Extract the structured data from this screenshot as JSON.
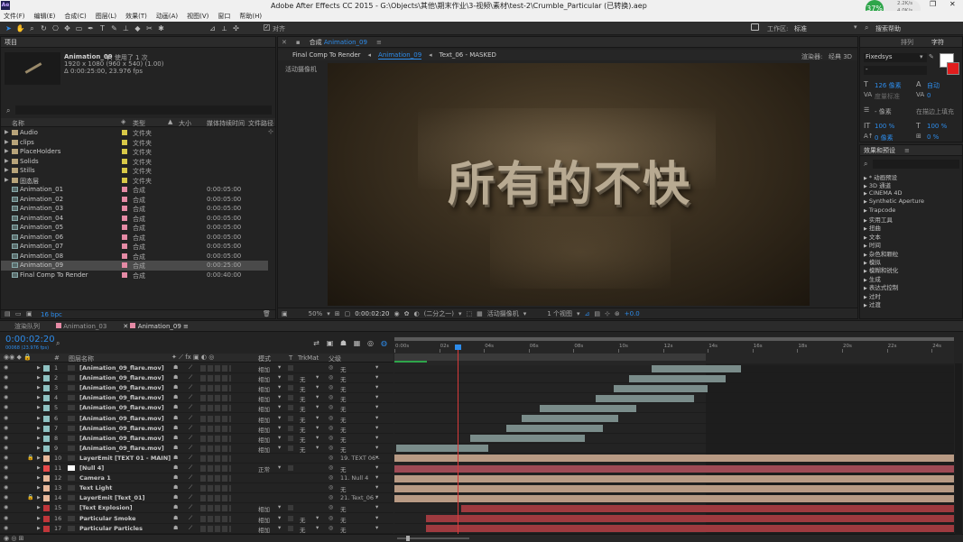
{
  "window": {
    "title": "Adobe After Effects CC 2015 - G:\\Objects\\其他\\期末作业\\3-视频\\素材\\test-2\\Crumble_Particular (已转换).aep",
    "app_icon": "Ae",
    "percent": "37%",
    "net_up": "2.2K/s",
    "net_down": "4.0K/s"
  },
  "menu": [
    "文件(F)",
    "编辑(E)",
    "合成(C)",
    "图层(L)",
    "效果(T)",
    "动画(A)",
    "视图(V)",
    "窗口",
    "帮助(H)"
  ],
  "toolbar": {
    "align": "对齐",
    "workspace_label": "工作区:",
    "workspace_value": "标准",
    "search": "搜索帮助"
  },
  "project": {
    "tab": "项目",
    "thumb_name": "Animation_09",
    "used": "▼, 使用了 1 次",
    "resolution": "1920 x 1080 (960 x 540) (1.00)",
    "duration": "Δ 0:00:25:00, 23.976 fps",
    "search_placeholder": "",
    "cols": {
      "name": "名称",
      "type": "类型",
      "size": "大小",
      "duration": "媒体持续时间",
      "path": "文件路径"
    },
    "items": [
      {
        "name": "Audio",
        "type": "文件夹",
        "dur": "",
        "color": "#d8c847",
        "kind": "folder"
      },
      {
        "name": "clips",
        "type": "文件夹",
        "dur": "",
        "color": "#d8c847",
        "kind": "folder"
      },
      {
        "name": "PlaceHolders",
        "type": "文件夹",
        "dur": "",
        "color": "#d8c847",
        "kind": "folder"
      },
      {
        "name": "Solids",
        "type": "文件夹",
        "dur": "",
        "color": "#d8c847",
        "kind": "folder"
      },
      {
        "name": "Stills",
        "type": "文件夹",
        "dur": "",
        "color": "#d8c847",
        "kind": "folder"
      },
      {
        "name": "固态层",
        "type": "文件夹",
        "dur": "",
        "color": "#d8c847",
        "kind": "folder"
      },
      {
        "name": "Animation_01",
        "type": "合成",
        "dur": "0:00:05:00",
        "color": "#e58aa5",
        "kind": "comp"
      },
      {
        "name": "Animation_02",
        "type": "合成",
        "dur": "0:00:05:00",
        "color": "#e58aa5",
        "kind": "comp"
      },
      {
        "name": "Animation_03",
        "type": "合成",
        "dur": "0:00:05:00",
        "color": "#e58aa5",
        "kind": "comp"
      },
      {
        "name": "Animation_04",
        "type": "合成",
        "dur": "0:00:05:00",
        "color": "#e58aa5",
        "kind": "comp"
      },
      {
        "name": "Animation_05",
        "type": "合成",
        "dur": "0:00:05:00",
        "color": "#e58aa5",
        "kind": "comp"
      },
      {
        "name": "Animation_06",
        "type": "合成",
        "dur": "0:00:05:00",
        "color": "#e58aa5",
        "kind": "comp"
      },
      {
        "name": "Animation_07",
        "type": "合成",
        "dur": "0:00:05:00",
        "color": "#e58aa5",
        "kind": "comp"
      },
      {
        "name": "Animation_08",
        "type": "合成",
        "dur": "0:00:05:00",
        "color": "#e58aa5",
        "kind": "comp"
      },
      {
        "name": "Animation_09",
        "type": "合成",
        "dur": "0:00:25:00",
        "color": "#e58aa5",
        "kind": "comp"
      },
      {
        "name": "Final Comp To Render",
        "type": "合成",
        "dur": "0:00:40:00",
        "color": "#e58aa5",
        "kind": "comp"
      }
    ],
    "bpc": "16 bpc"
  },
  "comp": {
    "tab": "合成",
    "tab_name": "Animation_09",
    "crumbs": [
      "Final Comp To Render",
      "Animation_09",
      "Text_06 - MASKED"
    ],
    "renderer_label": "渲染器:",
    "renderer_value": "经典 3D",
    "camera_label": "活动摄像机",
    "viewer_text": "所有的不快",
    "zoom": "50%",
    "time": "0:00:02:20",
    "resolution": "(二分之一)",
    "camera": "活动摄像机",
    "views": "1 个视图",
    "exposure": "+0.0"
  },
  "right": {
    "tabs": [
      "排列",
      "字符"
    ],
    "font": "Fixedsys",
    "style": "-",
    "size": "126 像素",
    "leading": "自动",
    "tracking_label": "度量标准",
    "kern": "0",
    "stroke": "- 像素",
    "stroke_mode": "在描边上填充",
    "vscale": "100 %",
    "hscale": "100 %",
    "baseline": "0 像素",
    "tsume": "0 %",
    "effects_tab": "效果和预设",
    "effects": [
      "* 动画预设",
      "3D 通道",
      "CINEMA 4D",
      "Synthetic Aperture",
      "Trapcode",
      "实用工具",
      "扭曲",
      "文本",
      "时间",
      "杂色和颗粒",
      "模拟",
      "模糊和锐化",
      "生成",
      "表达式控制",
      "过时",
      "过渡"
    ]
  },
  "timeline": {
    "tabs": [
      "渲染队列",
      "Animation_03",
      "Animation_09"
    ],
    "time": "0:00:02:20",
    "fps": "00068 (23.976 fps)",
    "cols": {
      "num": "#",
      "name": "图层名称",
      "mode": "模式",
      "t": "T",
      "trkmat": "TrkMat",
      "parent": "父级"
    },
    "ruler": [
      "0:00s",
      "02s",
      "04s",
      "06s",
      "08s",
      "10s",
      "12s",
      "14s",
      "16s",
      "18s",
      "20s",
      "22s",
      "24s"
    ],
    "playhead": 2.83,
    "layers": [
      {
        "n": "1",
        "name": "[Animation_09_flare.mov]",
        "mode": "相加",
        "trk": "",
        "parent": "无",
        "color": "#8fc2c2",
        "start": 11.5,
        "end": 15.5,
        "bar": "#7a8c8a"
      },
      {
        "n": "2",
        "name": "[Animation_09_flare.mov]",
        "mode": "相加",
        "trk": "无",
        "parent": "无",
        "color": "#8fc2c2",
        "start": 10.5,
        "end": 14.8,
        "bar": "#7a8c8a"
      },
      {
        "n": "3",
        "name": "[Animation_09_flare.mov]",
        "mode": "相加",
        "trk": "无",
        "parent": "无",
        "color": "#8fc2c2",
        "start": 9.8,
        "end": 14.0,
        "bar": "#7a8c8a"
      },
      {
        "n": "4",
        "name": "[Animation_09_flare.mov]",
        "mode": "相加",
        "trk": "无",
        "parent": "无",
        "color": "#8fc2c2",
        "start": 9.0,
        "end": 13.4,
        "bar": "#7a8c8a"
      },
      {
        "n": "5",
        "name": "[Animation_09_flare.mov]",
        "mode": "相加",
        "trk": "无",
        "parent": "无",
        "color": "#8fc2c2",
        "start": 6.5,
        "end": 10.8,
        "bar": "#7a8c8a"
      },
      {
        "n": "6",
        "name": "[Animation_09_flare.mov]",
        "mode": "相加",
        "trk": "无",
        "parent": "无",
        "color": "#8fc2c2",
        "start": 5.7,
        "end": 10.0,
        "bar": "#7a8c8a"
      },
      {
        "n": "7",
        "name": "[Animation_09_flare.mov]",
        "mode": "相加",
        "trk": "无",
        "parent": "无",
        "color": "#8fc2c2",
        "start": 5.0,
        "end": 9.3,
        "bar": "#7a8c8a"
      },
      {
        "n": "8",
        "name": "[Animation_09_flare.mov]",
        "mode": "相加",
        "trk": "无",
        "parent": "无",
        "color": "#8fc2c2",
        "start": 3.4,
        "end": 8.5,
        "bar": "#7a8c8a"
      },
      {
        "n": "9",
        "name": "[Animation_09_flare.mov]",
        "mode": "相加",
        "trk": "无",
        "parent": "无",
        "color": "#8fc2c2",
        "start": 0.1,
        "end": 4.2,
        "bar": "#7a8c8a"
      },
      {
        "n": "10",
        "name": "LayerEmit [TEXT 01 - MAIN]",
        "mode": "",
        "trk": "",
        "parent": "19. TEXT 06 -",
        "color": "#e8b89a",
        "start": 0,
        "end": 25,
        "bar": "#b89a84"
      },
      {
        "n": "11",
        "name": "[Null 4]",
        "mode": "正常",
        "trk": "",
        "parent": "无",
        "color": "#e84a4a",
        "start": 0,
        "end": 25,
        "bar": "#9e4a55"
      },
      {
        "n": "12",
        "name": "Camera 1",
        "mode": "",
        "trk": "",
        "parent": "11. Null 4",
        "color": "#e8b89a",
        "start": 0,
        "end": 25,
        "bar": "#b89a84"
      },
      {
        "n": "13",
        "name": "Text Light",
        "mode": "",
        "trk": "",
        "parent": "无",
        "color": "#e8b89a",
        "start": 0,
        "end": 25,
        "bar": "#b89a84"
      },
      {
        "n": "14",
        "name": "LayerEmit [Text_01]",
        "mode": "",
        "trk": "",
        "parent": "21. Text_06 -",
        "color": "#e8b89a",
        "start": 0,
        "end": 25,
        "bar": "#b89a84"
      },
      {
        "n": "15",
        "name": "[Text Explosion]",
        "mode": "相加",
        "trk": "",
        "parent": "无",
        "color": "#c0363a",
        "start": 3.0,
        "end": 25,
        "bar": "#9e3a3f"
      },
      {
        "n": "16",
        "name": "Particular Smoke",
        "mode": "相加",
        "trk": "无",
        "parent": "无",
        "color": "#c0363a",
        "start": 1.4,
        "end": 25,
        "bar": "#9e3a3f"
      },
      {
        "n": "17",
        "name": "Particular Particles",
        "mode": "相加",
        "trk": "无",
        "parent": "无",
        "color": "#c0363a",
        "start": 1.4,
        "end": 25,
        "bar": "#9e3a3f"
      }
    ]
  }
}
